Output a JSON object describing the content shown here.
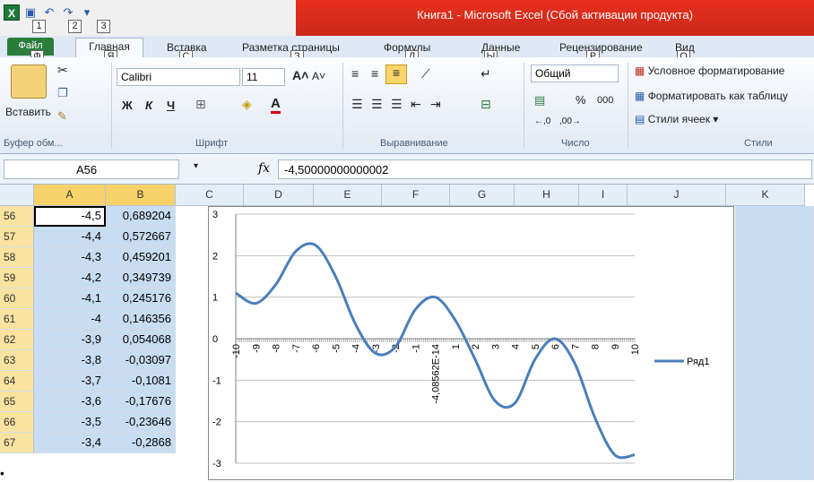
{
  "window": {
    "title": "Книга1 - Microsoft Excel (Сбой активации продукта)"
  },
  "qat_keytips": [
    "1",
    "2",
    "3"
  ],
  "tabs": [
    {
      "label": "Файл",
      "keytip": "Ф"
    },
    {
      "label": "Главная",
      "keytip": "Я"
    },
    {
      "label": "Вставка",
      "keytip": "С"
    },
    {
      "label": "Разметка страницы",
      "keytip": "З"
    },
    {
      "label": "Формулы",
      "keytip": "Л"
    },
    {
      "label": "Данные",
      "keytip": "Ы"
    },
    {
      "label": "Рецензирование",
      "keytip": "Р"
    },
    {
      "label": "Вид",
      "keytip": "О"
    }
  ],
  "ribbon": {
    "clipboard": {
      "paste": "Вставить",
      "label": "Буфер обм..."
    },
    "font": {
      "name": "Calibri",
      "size": "11",
      "bold": "Ж",
      "italic": "К",
      "underline": "Ч",
      "label": "Шрифт"
    },
    "alignment": {
      "label": "Выравнивание"
    },
    "number": {
      "format": "Общий",
      "percent": "%",
      "thousands": "000",
      "label": "Число"
    },
    "styles": {
      "conditional": "Условное форматирование",
      "format_table": "Форматировать как таблицу",
      "cell_styles": "Стили ячеек ▾",
      "label": "Стили"
    }
  },
  "formula_bar": {
    "name_box": "A56",
    "fx": "fx",
    "value": "-4,50000000000002"
  },
  "columns": [
    "A",
    "B",
    "C",
    "D",
    "E",
    "F",
    "G",
    "H",
    "I",
    "J",
    "K"
  ],
  "rows": [
    {
      "n": "56",
      "a": "-4,5",
      "b": "0,689204"
    },
    {
      "n": "57",
      "a": "-4,4",
      "b": "0,572667"
    },
    {
      "n": "58",
      "a": "-4,3",
      "b": "0,459201"
    },
    {
      "n": "59",
      "a": "-4,2",
      "b": "0,349739"
    },
    {
      "n": "60",
      "a": "-4,1",
      "b": "0,245176"
    },
    {
      "n": "61",
      "a": "-4",
      "b": "0,146356"
    },
    {
      "n": "62",
      "a": "-3,9",
      "b": "0,054068"
    },
    {
      "n": "63",
      "a": "-3,8",
      "b": "-0,03097"
    },
    {
      "n": "64",
      "a": "-3,7",
      "b": "-0,1081"
    },
    {
      "n": "65",
      "a": "-3,6",
      "b": "-0,17676"
    },
    {
      "n": "66",
      "a": "-3,5",
      "b": "-0,23646"
    },
    {
      "n": "67",
      "a": "-3,4",
      "b": "-0,2868"
    }
  ],
  "chart_data": {
    "type": "line",
    "legend": "right",
    "ylim": [
      -3,
      3
    ],
    "yticks": [
      "3",
      "2",
      "1",
      "0",
      "-1",
      "-2",
      "-3"
    ],
    "xticks": [
      "-10",
      "-9",
      "-8",
      "-7",
      "-6",
      "-5",
      "-4",
      "-3",
      "-2",
      "-1",
      "-4,08562E-14",
      "1",
      "2",
      "3",
      "4",
      "5",
      "6",
      "7",
      "8",
      "9",
      "10"
    ],
    "series": [
      {
        "name": "Ряд1",
        "color": "#4a7ebb",
        "x": [
          -10,
          -9,
          -8,
          -7,
          -6,
          -5,
          -4,
          -3,
          -2,
          -1,
          0,
          1,
          2,
          3,
          4,
          5,
          6,
          7,
          8,
          9,
          10
        ],
        "y": [
          1.1,
          0.85,
          1.3,
          2.1,
          2.25,
          1.5,
          0.35,
          -0.35,
          -0.2,
          0.7,
          1.0,
          0.45,
          -0.5,
          -1.5,
          -1.55,
          -0.5,
          0.0,
          -0.6,
          -1.9,
          -2.8,
          -2.8
        ]
      }
    ]
  },
  "colors": {
    "title_red": "#d62b1c",
    "selection": "#c8dcf2",
    "series": "#4a7ebb"
  }
}
